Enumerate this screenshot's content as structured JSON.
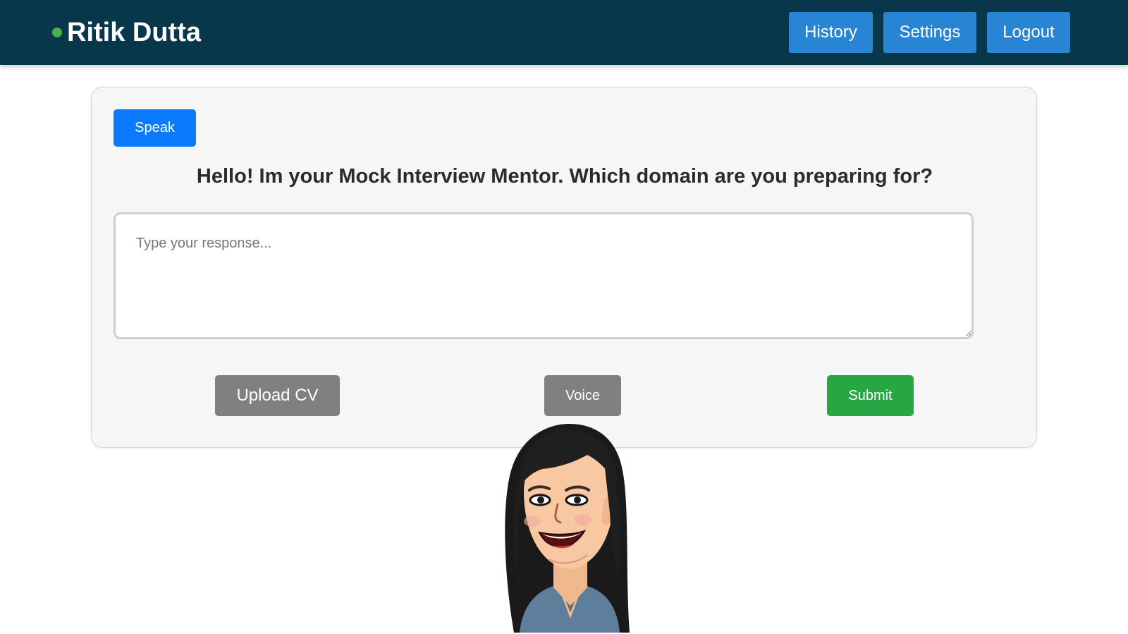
{
  "header": {
    "user_name": "Ritik Dutta",
    "status_color": "#4caf50",
    "nav": {
      "history_label": "History",
      "settings_label": "Settings",
      "logout_label": "Logout"
    }
  },
  "main": {
    "speak_label": "Speak",
    "question": "Hello! Im your Mock Interview Mentor. Which domain are you preparing for?",
    "response_placeholder": "Type your response...",
    "response_value": "",
    "upload_label": "Upload CV",
    "voice_label": "Voice",
    "submit_label": "Submit"
  },
  "avatar": {
    "icon": "female-mentor-avatar"
  },
  "colors": {
    "header_bg": "#08364a",
    "nav_button": "#2785d3",
    "speak_button": "#0a7bfc",
    "grey_button": "#808080",
    "submit_button": "#27a744"
  }
}
